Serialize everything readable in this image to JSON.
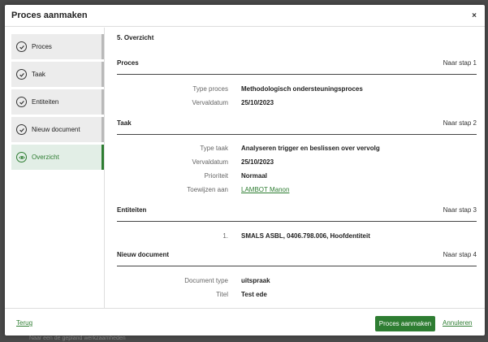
{
  "modal": {
    "title": "Proces aanmaken",
    "close_icon": "×"
  },
  "sidebar": {
    "items": [
      {
        "label": "Proces",
        "icon": "check-circle-icon",
        "active": false
      },
      {
        "label": "Taak",
        "icon": "check-circle-icon",
        "active": false
      },
      {
        "label": "Entiteiten",
        "icon": "check-circle-icon",
        "active": false
      },
      {
        "label": "Nieuw document",
        "icon": "check-circle-icon",
        "active": false
      },
      {
        "label": "Overzicht",
        "icon": "eye-icon",
        "active": true
      }
    ]
  },
  "content": {
    "step_title": "5. Overzicht",
    "sections": {
      "proces": {
        "name": "Proces",
        "link": "Naar stap 1",
        "fields": [
          {
            "key": "Type proces",
            "value": "Methodologisch ondersteuningsproces"
          },
          {
            "key": "Vervaldatum",
            "value": "25/10/2023"
          }
        ]
      },
      "taak": {
        "name": "Taak",
        "link": "Naar stap 2",
        "fields": [
          {
            "key": "Type taak",
            "value": "Analyseren trigger en beslissen over vervolg"
          },
          {
            "key": "Vervaldatum",
            "value": "25/10/2023"
          },
          {
            "key": "Prioriteit",
            "value": "Normaal"
          },
          {
            "key": "Toewijzen aan",
            "value": "LAMBOT Manon"
          }
        ]
      },
      "entiteiten": {
        "name": "Entiteiten",
        "link": "Naar stap 3",
        "fields": [
          {
            "key": "1.",
            "value": "SMALS ASBL, 0406.798.006, Hoofdentiteit"
          }
        ]
      },
      "document": {
        "name": "Nieuw document",
        "link": "Naar stap 4",
        "fields": [
          {
            "key": "Document type",
            "value": "uitspraak"
          },
          {
            "key": "Titel",
            "value": "Test ede"
          }
        ]
      }
    }
  },
  "footer": {
    "back": "Terug",
    "primary": "Proces aanmaken",
    "cancel": "Annuleren"
  },
  "background": {
    "ghost_text": "Naar een de gepland werkzaamheden"
  },
  "colors": {
    "accent": "#2e7d32",
    "step_bg": "#ececec",
    "active_step_bg": "#e2eee6"
  }
}
